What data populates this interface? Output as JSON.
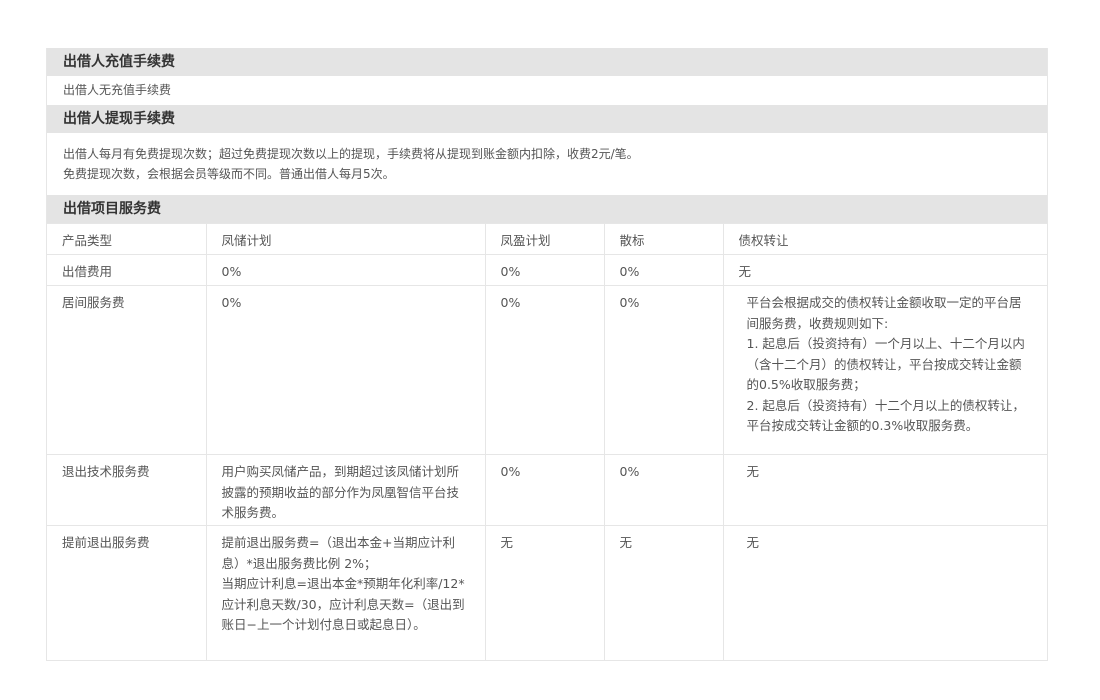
{
  "sections": {
    "recharge": {
      "title": "出借人充值手续费",
      "body": "出借人无充值手续费"
    },
    "withdraw": {
      "title": "出借人提现手续费",
      "line1": "出借人每月有免费提现次数；超过免费提现次数以上的提现，手续费将从提现到账金额内扣除，收费2元/笔。",
      "line2": "免费提现次数，会根据会员等级而不同。普通出借人每月5次。"
    },
    "service": {
      "title": "出借项目服务费"
    }
  },
  "table": {
    "headers": [
      "产品类型",
      "凤储计划",
      "凤盈计划",
      "散标",
      "债权转让"
    ],
    "rows": [
      {
        "label": "出借费用",
        "fengchu": "0%",
        "fengying": "0%",
        "sanbiao": "0%",
        "zhaiquan": "无"
      },
      {
        "label": "居间服务费",
        "fengchu": "0%",
        "fengying": "0%",
        "sanbiao": "0%",
        "zhaiquan": "平台会根据成交的债权转让金额收取一定的平台居间服务费，收费规则如下:\n1. 起息后（投资持有）一个月以上、十二个月以内（含十二个月）的债权转让，平台按成交转让金额的0.5%收取服务费；\n2. 起息后（投资持有）十二个月以上的债权转让，平台按成交转让金额的0.3%收取服务费。"
      },
      {
        "label": "退出技术服务费",
        "fengchu": "用户购买凤储产品，到期超过该凤储计划所披露的预期收益的部分作为凤凰智信平台技术服务费。",
        "fengying": "0%",
        "sanbiao": "0%",
        "zhaiquan": "无"
      },
      {
        "label": "提前退出服务费",
        "fengchu": "提前退出服务费=（退出本金+当期应计利息）*退出服务费比例 2%；\n当期应计利息=退出本金*预期年化利率/12*应计利息天数/30，应计利息天数=（退出到账日−上一个计划付息日或起息日）。",
        "fengying": "无",
        "sanbiao": "无",
        "zhaiquan": "无"
      }
    ]
  }
}
